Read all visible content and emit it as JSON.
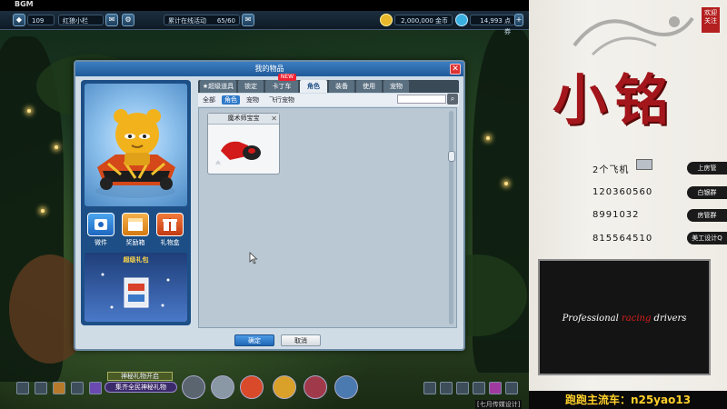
{
  "app": {
    "bgm_label": "BGM"
  },
  "topbar": {
    "level_text": "109",
    "name_text": "红狼小栏",
    "event_text": "累计在线活动",
    "event_count": "65/60",
    "coins_text": "2,000,000 金币",
    "points_text": "14,993 点券",
    "plus_icon": "plus-icon"
  },
  "dialog": {
    "title": "我的物品",
    "close_label": "✕",
    "tabs": [
      "★超级道具",
      "锁定",
      "卡丁车",
      "角色",
      "装备",
      "使用",
      "宠物"
    ],
    "tab_new_badge": "NEW",
    "subtabs": [
      "全部",
      "角色",
      "宠物",
      "飞行宠物"
    ],
    "search_placeholder": "",
    "left": {
      "actions": [
        "微件",
        "奖励箱",
        "礼物盒"
      ],
      "gift_pack_title": "超级礼包"
    },
    "item": {
      "name": "魔术师宝宝",
      "close_label": "✕"
    },
    "confirm_label": "确定",
    "cancel_label": "取消"
  },
  "bottom": {
    "event_title": "神秘礼物开启",
    "event_sub": "集齐全民神秘礼物"
  },
  "overlay": {
    "seal_text": "欢迎关注",
    "title": "小铭",
    "rows": [
      {
        "text": "2个飞机",
        "tag": "上房管"
      },
      {
        "text": "120360560",
        "tag": "白银群"
      },
      {
        "text": "8991032",
        "tag": "房管群"
      },
      {
        "text": "815564510",
        "tag": "美工设计Q"
      }
    ],
    "banner_pre": "Professional ",
    "banner_racing": "racing",
    "banner_post": " drivers",
    "footer": "跑跑主流车：n25yao13",
    "watermark": "[七月传媒设计]"
  },
  "colors": {
    "accent_blue": "#2f79c9",
    "title_red": "#a3161b",
    "footer_gold": "#ffd02a"
  }
}
